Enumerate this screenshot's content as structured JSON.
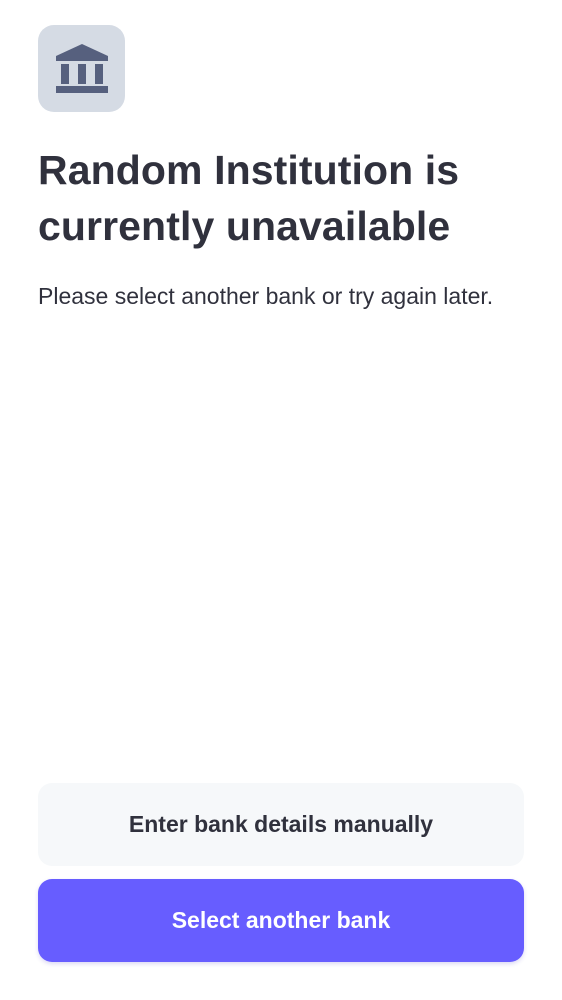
{
  "icon": {
    "name": "bank-icon",
    "tile_color": "#d5dbe4",
    "glyph_color": "#56607e"
  },
  "title": "Random Institution is currently unavailable",
  "subtitle": "Please select another bank or try again later.",
  "buttons": {
    "manual_label": "Enter bank details manually",
    "select_label": "Select another bank"
  },
  "colors": {
    "text": "#30313d",
    "primary": "#675dff",
    "secondary_bg": "#f6f8fa"
  }
}
